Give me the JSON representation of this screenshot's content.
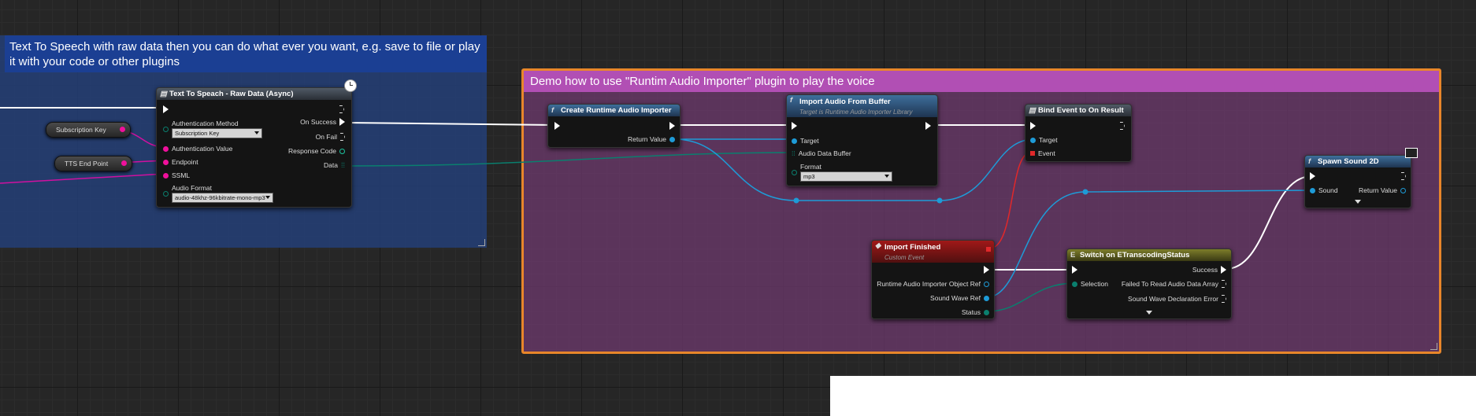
{
  "comments": {
    "tts_comment": "Text To Speech with raw data then you can do what ever you want, e.g. save to file or play it with your code or other plugins",
    "demo_comment": "Demo how to use \"Runtim Audio Importer\" plugin to play the voice"
  },
  "variables": {
    "subscription_key": "Subscription Key",
    "tts_end_point": "TTS End Point"
  },
  "tts_node": {
    "title": "Text To Speach - Raw Data (Async)",
    "auth_method_label": "Authentication Method",
    "auth_method_value": "Subscription Key",
    "auth_value_label": "Authentication Value",
    "endpoint_label": "Endpoint",
    "ssml_label": "SSML",
    "audio_format_label": "Audio Format",
    "audio_format_value": "audio-48khz-96kbitrate-mono-mp3",
    "on_success": "On Success",
    "on_fail": "On Fail",
    "response_code": "Response Code",
    "data": "Data"
  },
  "create_node": {
    "icon": "f",
    "title": "Create Runtime Audio Importer",
    "return_value": "Return Value"
  },
  "import_node": {
    "icon": "f",
    "title": "Import Audio From Buffer",
    "subtitle": "Target is Runtime Audio Importer Library",
    "target": "Target",
    "audio_data_buffer": "Audio Data Buffer",
    "format_label": "Format",
    "format_value": "mp3"
  },
  "bind_node": {
    "title": "Bind Event to On Result",
    "target": "Target",
    "event": "Event"
  },
  "import_finished_node": {
    "title": "Import Finished",
    "subtitle": "Custom Event",
    "importer_ref": "Runtime Audio Importer Object Ref",
    "sound_wave_ref": "Sound Wave Ref",
    "status": "Status"
  },
  "switch_node": {
    "icon": "E",
    "title": "Switch on ETranscodingStatus",
    "selection": "Selection",
    "success": "Success",
    "failed_read": "Failed To Read Audio Data Array",
    "sound_wave_error": "Sound Wave Declaration Error"
  },
  "spawn_node": {
    "icon": "f",
    "title": "Spawn Sound 2D",
    "sound": "Sound",
    "return_value": "Return Value"
  },
  "colors": {
    "exec": "#ffffff",
    "object": "#1e9bd7",
    "string": "#f0109c",
    "byte": "#0a7f6e",
    "delegate": "#e0282a"
  }
}
